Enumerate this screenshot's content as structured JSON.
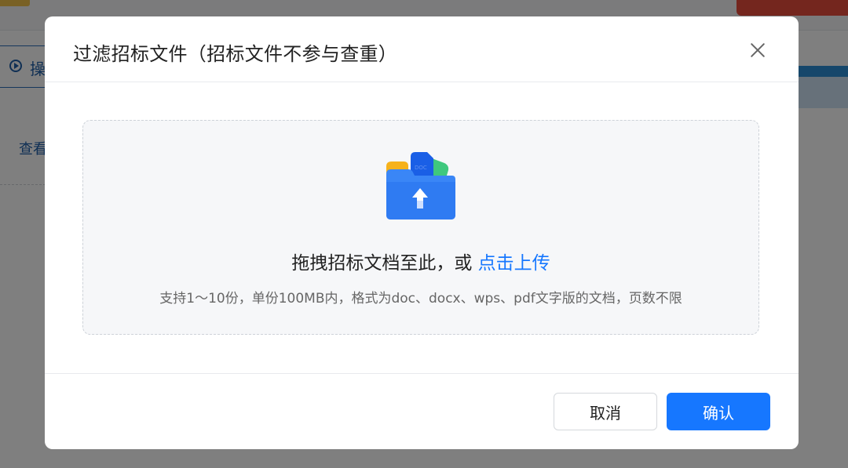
{
  "background": {
    "op_label": "操",
    "view_label": "查看"
  },
  "dialog": {
    "title": "过滤招标文件（招标文件不参与查重）",
    "upload": {
      "drag_text": "拖拽招标文档至此，或",
      "link_text": "点击上传",
      "hint": "支持1～10份，单份100MB内，格式为doc、docx、wps、pdf文字版的文档，页数不限",
      "icon": "folder-upload-icon"
    },
    "buttons": {
      "cancel": "取消",
      "confirm": "确认"
    }
  },
  "colors": {
    "accent": "#1677ff",
    "overlay": "rgba(0,0,0,0.5)"
  }
}
